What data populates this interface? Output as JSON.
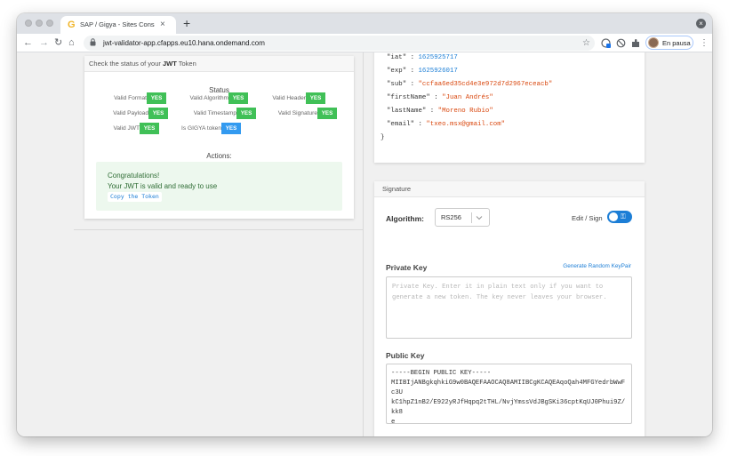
{
  "browser": {
    "tab_title": "SAP / Gigya - Sites Console To",
    "tab_favicon": "G",
    "tab_close": "×",
    "new_tab": "+",
    "window_control": "×",
    "back": "←",
    "forward": "→",
    "reload": "↻",
    "home": "⌂",
    "url": "jwt-validator-app.cfapps.eu10.hana.ondemand.com",
    "star": "☆",
    "kebab": "⋮",
    "profile_label": "En pausa",
    "accent_color": "#1a73e8"
  },
  "status_card": {
    "header_prefix": "Check the status of your ",
    "header_bold": "JWT",
    "header_suffix": " Token",
    "status_title": "Status",
    "checks": [
      {
        "label": "Valid Format",
        "badge": "YES",
        "color": "#40c057"
      },
      {
        "label": "Valid Algorithm",
        "badge": "YES",
        "color": "#40c057"
      },
      {
        "label": "Valid Header",
        "badge": "YES",
        "color": "#40c057"
      },
      {
        "label": "Valid Payload",
        "badge": "YES",
        "color": "#40c057"
      },
      {
        "label": "Valid Timestamp",
        "badge": "YES",
        "color": "#40c057"
      },
      {
        "label": "Valid Signature",
        "badge": "YES",
        "color": "#40c057"
      },
      {
        "label": "Valid JWT",
        "badge": "YES",
        "color": "#40c057"
      },
      {
        "label": "Is GIGYA token",
        "badge": "YES",
        "color": "#339af0"
      }
    ],
    "actions_title": "Actions:",
    "congrats_line1": "Congratulations!",
    "congrats_line2": "Your JWT is valid and ready to use",
    "copy_button": "Copy the Token"
  },
  "payload": {
    "lines": [
      {
        "key": "\"iat\"",
        "sep": " : ",
        "value": "1625925717",
        "type": "num"
      },
      {
        "key": "\"exp\"",
        "sep": " : ",
        "value": "1625926017",
        "type": "num"
      },
      {
        "key": "\"sub\"",
        "sep": " : ",
        "value": "\"ccfaa6ed35cd4e3e972d7d2967eceacb\"",
        "type": "str"
      },
      {
        "key": "\"firstName\"",
        "sep": " : ",
        "value": "\"Juan Andrés\"",
        "type": "str"
      },
      {
        "key": "\"lastName\"",
        "sep": " : ",
        "value": "\"Moreno Rubio\"",
        "type": "str"
      },
      {
        "key": "\"email\"",
        "sep": " : ",
        "value": "\"txeo.msx@gmail.com\"",
        "type": "str"
      }
    ],
    "closing_brace": "}"
  },
  "signature": {
    "header": "Signature",
    "algorithm_label": "Algorithm:",
    "algorithm_value": "RS256",
    "edit_sign_label": "Edit / Sign",
    "toggle_key_icon": "⚿",
    "private_key_label": "Private Key",
    "generate_link": "Generate Random KeyPair",
    "private_key_placeholder": "Private Key. Enter it in plain text only if you want to generate a new token. The key never leaves your browser.",
    "public_key_label": "Public Key",
    "public_key_value": "-----BEGIN PUBLIC KEY-----\nMIIBIjANBgkqhkiG9w0BAQEFAAOCAQ8AMIIBCgKCAQEAqoQah4MFGYedrbWwFc3U\nkC1hpZ1nB2/E922yRJfHqpq2tTHL/NvjYmssVdJBgSKi36cptKqUJ0Phui9Z/kk8\ne"
  }
}
